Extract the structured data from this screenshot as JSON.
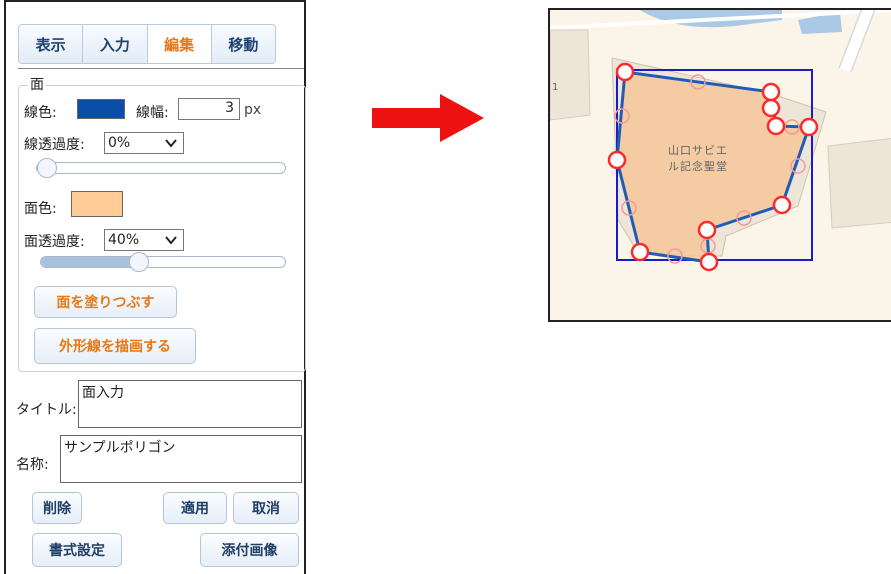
{
  "tabs": [
    {
      "label": "表示",
      "active": false
    },
    {
      "label": "入力",
      "active": false
    },
    {
      "label": "編集",
      "active": true
    },
    {
      "label": "移動",
      "active": false
    }
  ],
  "face": {
    "legend": "面",
    "line_color_label": "線色:",
    "line_color": "#0a4ea8",
    "line_width_label": "線幅:",
    "line_width_value": "3",
    "line_width_unit": "px",
    "line_opacity_label": "線透過度:",
    "line_opacity_value": "0%",
    "line_opacity_fraction": 0.0,
    "fill_color_label": "面色:",
    "fill_color": "#ffcb96",
    "fill_opacity_label": "面透過度:",
    "fill_opacity_value": "40%",
    "fill_opacity_fraction": 0.4,
    "fill_button": "面を塗りつぶす",
    "outline_button": "外形線を描画する"
  },
  "title_label": "タイトル:",
  "title_value": "面入力",
  "name_label": "名称:",
  "name_value": "サンプルポリゴン",
  "buttons": {
    "delete": "削除",
    "apply": "適用",
    "cancel": "取消",
    "format": "書式設定",
    "attach": "添付画像"
  },
  "map": {
    "building_label_line1": "山口サビエ",
    "building_label_line2": "ル記念聖堂",
    "edge_label": "1",
    "polygon_color": "#1f5cb8",
    "bbox_color": "#1a1acc",
    "vertex_color": "#ff2a2a"
  },
  "arrow_color": "#ee1111"
}
